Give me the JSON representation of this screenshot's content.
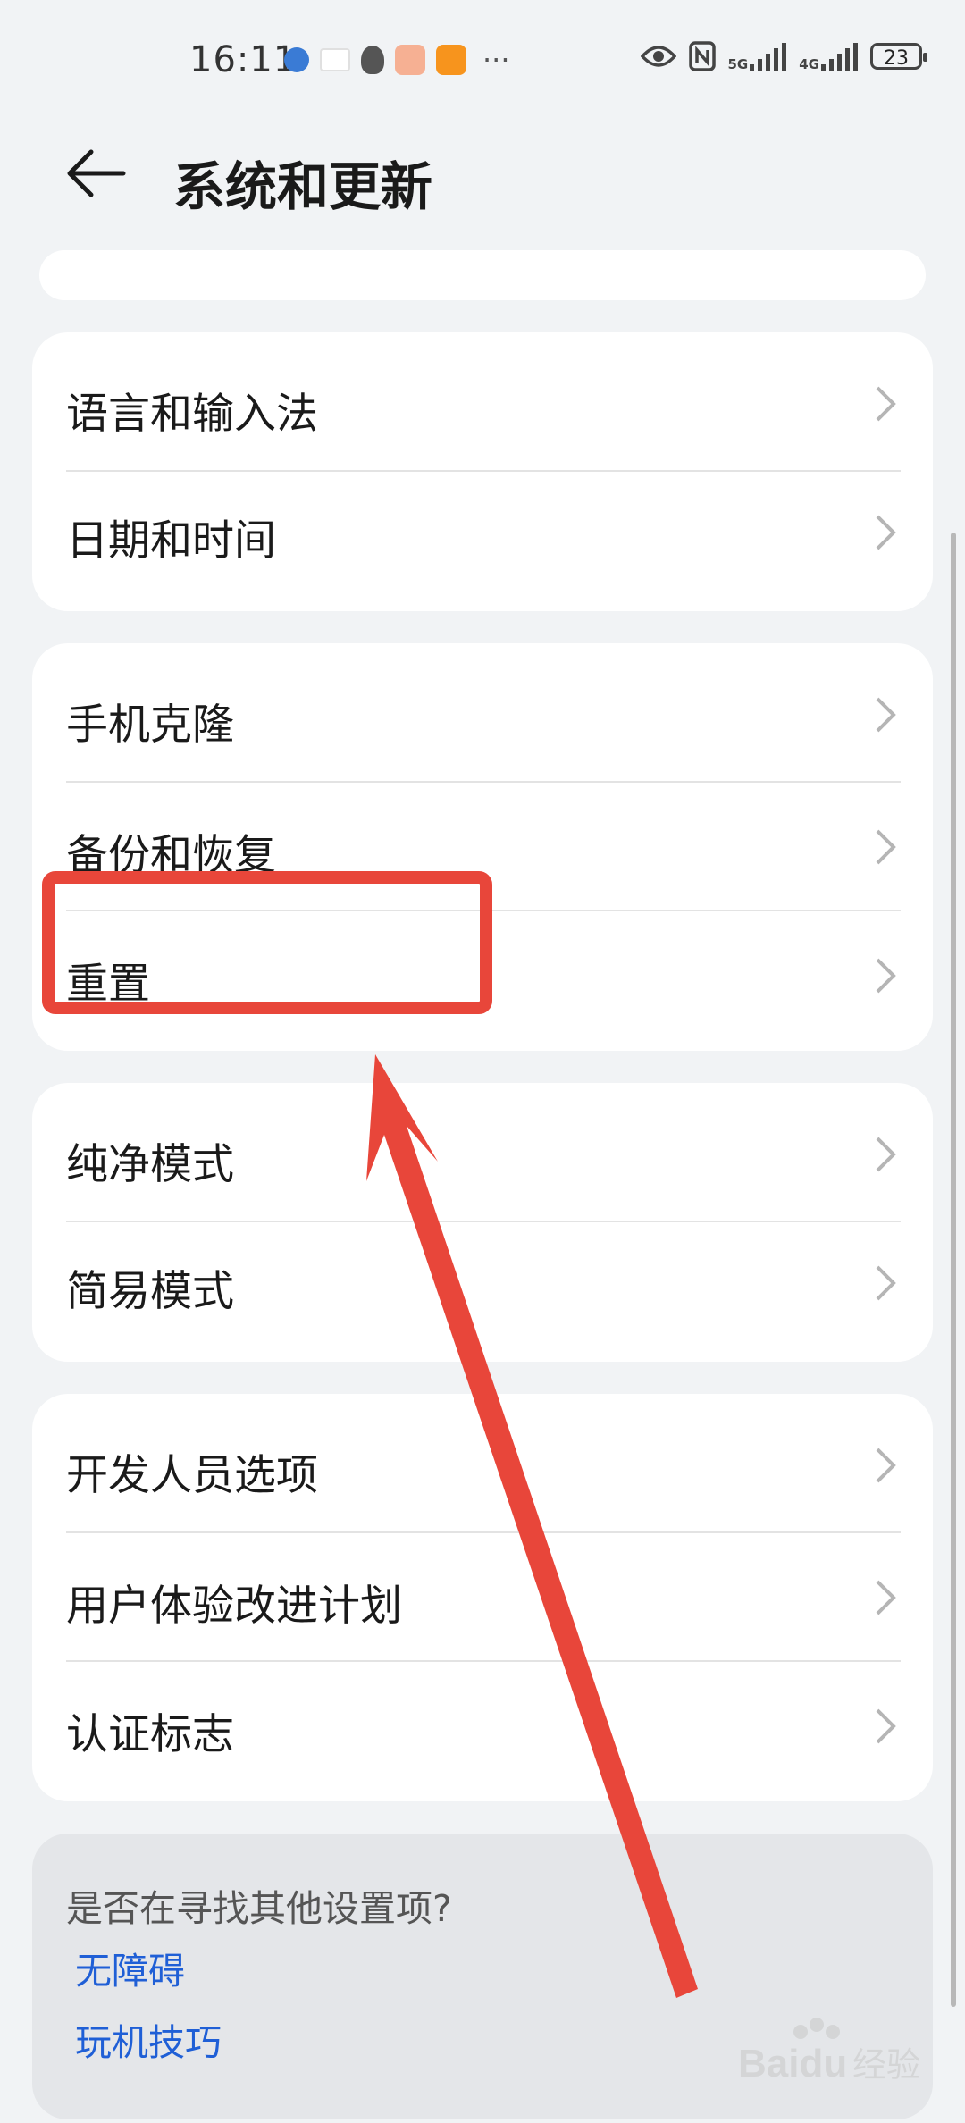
{
  "status_bar": {
    "time": "16:11",
    "battery": "23",
    "network_1": "5G",
    "network_2": "4G"
  },
  "header": {
    "title": "系统和更新"
  },
  "groups": [
    {
      "items": [
        {
          "label": "语言和输入法"
        },
        {
          "label": "日期和时间"
        }
      ]
    },
    {
      "items": [
        {
          "label": "手机克隆"
        },
        {
          "label": "备份和恢复"
        },
        {
          "label": "重置"
        }
      ]
    },
    {
      "items": [
        {
          "label": "纯净模式"
        },
        {
          "label": "简易模式"
        }
      ]
    },
    {
      "items": [
        {
          "label": "开发人员选项"
        },
        {
          "label": "用户体验改进计划"
        },
        {
          "label": "认证标志"
        }
      ]
    }
  ],
  "footer": {
    "question": "是否在寻找其他设置项?",
    "links": [
      "无障碍",
      "玩机技巧"
    ]
  },
  "colors": {
    "accent_link": "#1f5fd6",
    "annotation_red": "#e8463a"
  },
  "watermark": "Baidu经验"
}
